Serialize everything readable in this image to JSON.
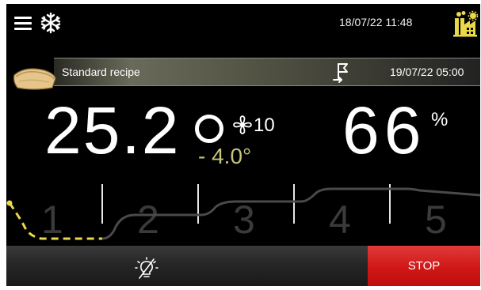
{
  "header": {
    "datetime": "18/07/22 11:48",
    "menu_icon": "hamburger-menu-icon",
    "mode_icon": "snowflake-icon",
    "factory_icon": "factory-icon"
  },
  "recipe": {
    "name": "Standard recipe",
    "end_time": "19/07/22 05:00",
    "icon": "bread-icon",
    "flag_icon": "finish-flag-icon"
  },
  "readouts": {
    "temperature": "25.2",
    "temperature_delta": "- 4.0°",
    "fan_speed": "10",
    "humidity": "66",
    "humidity_unit": "%"
  },
  "phases": {
    "labels": [
      "1",
      "2",
      "3",
      "4",
      "5"
    ],
    "current": 1
  },
  "controls": {
    "stop_label": "STOP",
    "light_icon": "light-off-icon"
  },
  "colors": {
    "background": "#000000",
    "accent_yellow": "#e8d84a",
    "delta_text": "#c7c47a",
    "stop_red": "#d01717"
  }
}
